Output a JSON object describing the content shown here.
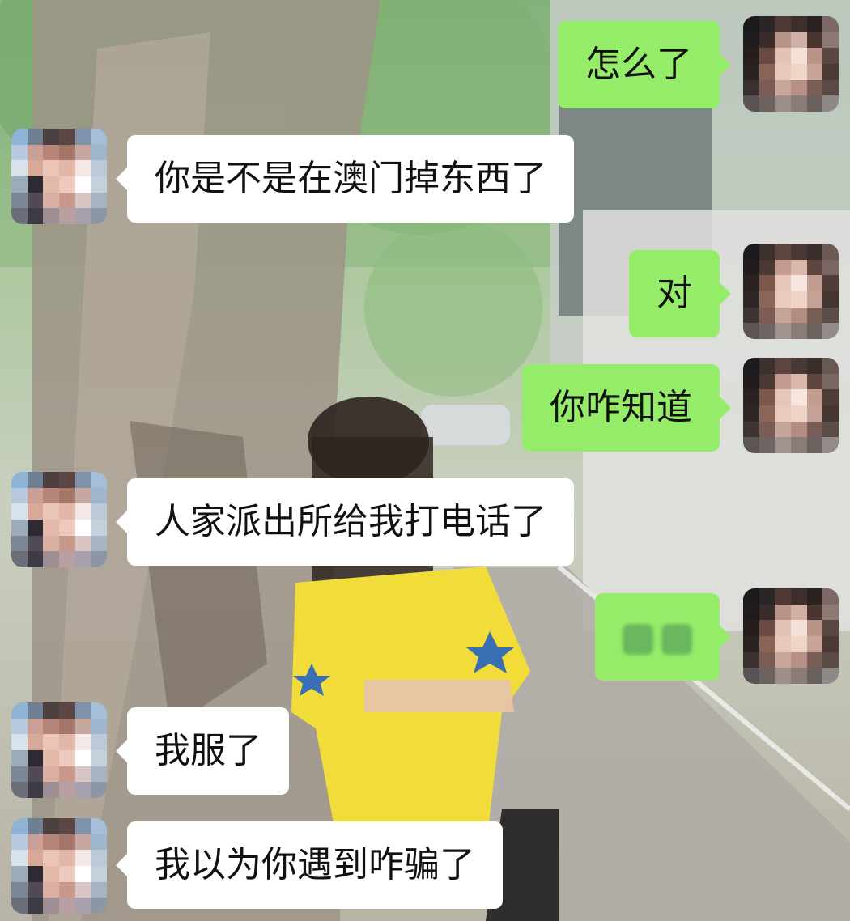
{
  "messages": [
    {
      "side": "out",
      "text": "怎么了"
    },
    {
      "side": "in",
      "text": "你是不是在澳门掉东西了"
    },
    {
      "side": "out",
      "text": "对"
    },
    {
      "side": "out",
      "text": "你咋知道"
    },
    {
      "side": "in",
      "text": "人家派出所给我打电话了"
    },
    {
      "side": "out",
      "text": "",
      "redacted": true
    },
    {
      "side": "in",
      "text": "我服了"
    },
    {
      "side": "in",
      "text": "我以为你遇到咋骗了"
    }
  ],
  "colors": {
    "incoming_bubble": "#ffffff",
    "outgoing_bubble": "#95ec69",
    "text": "#111111"
  },
  "icons": [
    "pixelated-avatar-contact",
    "pixelated-avatar-self"
  ]
}
